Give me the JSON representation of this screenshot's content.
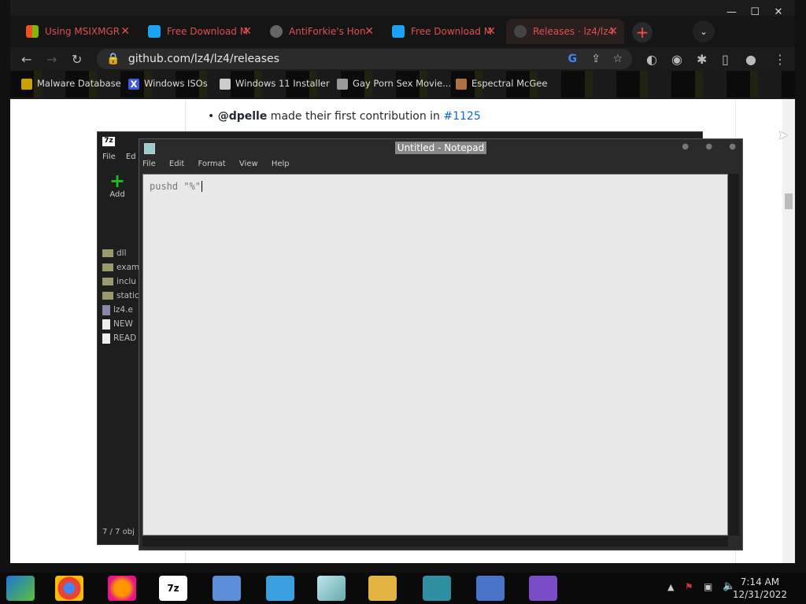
{
  "browser": {
    "tabs": [
      {
        "title": "Using MSIXMGR"
      },
      {
        "title": "Free Download M"
      },
      {
        "title": "AntiForkie's Hon"
      },
      {
        "title": "Free Download M"
      },
      {
        "title": "Releases · lz4/lz4"
      }
    ],
    "new_tab_label": "+",
    "url": "github.com/lz4/lz4/releases",
    "bookmarks": [
      {
        "label": "Malware Database"
      },
      {
        "label": "Windows ISOs"
      },
      {
        "label": "Windows 11 Installer"
      },
      {
        "label": "Gay Porn Sex Movie..."
      },
      {
        "label": "Espectral McGee"
      }
    ],
    "page": {
      "bullet_author": "@dpelle",
      "bullet_text": " made their first contribution in ",
      "bullet_link": "#1125"
    }
  },
  "sevenzip": {
    "menu": [
      "File",
      "Ed"
    ],
    "add_label": "Add",
    "items": [
      {
        "name": "dll",
        "type": "folder"
      },
      {
        "name": "exam",
        "type": "folder"
      },
      {
        "name": "inclu",
        "type": "folder"
      },
      {
        "name": "static",
        "type": "folder"
      },
      {
        "name": "lz4.e",
        "type": "exe"
      },
      {
        "name": "NEW",
        "type": "file"
      },
      {
        "name": "READ",
        "type": "file"
      }
    ],
    "status": "7 / 7 obj"
  },
  "notepad": {
    "title": "Untitled - Notepad",
    "menu": [
      "File",
      "Edit",
      "Format",
      "View",
      "Help"
    ],
    "content": "pushd \"%\""
  },
  "taskbar": {
    "time": "7:14 AM",
    "date": "12/31/2022"
  }
}
